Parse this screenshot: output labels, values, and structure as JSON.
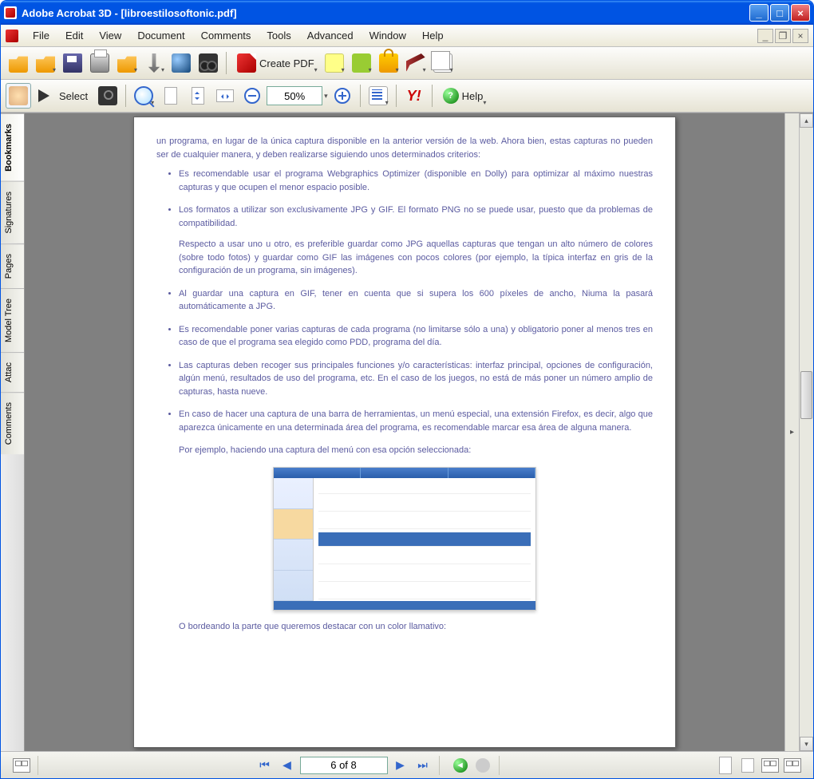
{
  "titlebar": {
    "text": "Adobe Acrobat 3D - [libroestilosoftonic.pdf]"
  },
  "menu": {
    "file": "File",
    "edit": "Edit",
    "view": "View",
    "document": "Document",
    "comments": "Comments",
    "tools": "Tools",
    "advanced": "Advanced",
    "window": "Window",
    "help": "Help"
  },
  "toolbar": {
    "create_pdf": "Create PDF",
    "select": "Select",
    "zoom": "50%",
    "help": "Help",
    "yahoo": "Y!"
  },
  "sidebar": {
    "bookmarks": "Bookmarks",
    "signatures": "Signatures",
    "pages": "Pages",
    "modeltree": "Model Tree",
    "attachments": "Attac",
    "comments": "Comments"
  },
  "status": {
    "page": "6 of 8"
  },
  "doc": {
    "intro": "un programa, en lugar de la única captura disponible en la anterior versión de la web. Ahora bien, estas capturas no pueden ser de cualquier manera, y deben realizarse siguiendo unos determinados criterios:",
    "b1": "Es recomendable usar el programa Webgraphics Optimizer (disponible en Dolly) para optimizar al máximo nuestras capturas y que ocupen el menor espacio posible.",
    "b2": "Los formatos a utilizar son exclusivamente JPG y GIF. El formato PNG no se puede usar, puesto que da problemas de compatibilidad.",
    "b2b": "Respecto a usar uno u otro, es preferible guardar como JPG aquellas capturas que tengan un alto número de colores (sobre todo fotos) y guardar como GIF las imágenes con pocos colores (por ejemplo, la típica interfaz en gris de la configuración de un programa, sin imágenes).",
    "b3": "Al guardar una captura en GIF, tener en cuenta que si supera los 600 píxeles de ancho, Niuma la pasará automáticamente a JPG.",
    "b4": "Es recomendable poner varias capturas de cada programa (no limitarse sólo a una) y obligatorio poner al menos tres en caso de que el programa sea elegido como PDD, programa del día.",
    "b5": "Las capturas deben recoger sus principales funciones y/o características: interfaz principal, opciones de configuración, algún menú, resultados de uso del programa, etc. En el caso de los juegos, no está de más poner un número amplio de capturas, hasta nueve.",
    "b6": "En caso de hacer una captura de una barra de herramientas, un menú especial, una extensión Firefox, es decir, algo que aparezca únicamente en una determinada área del programa, es recomendable marcar esa área de alguna manera.",
    "p2": "Por ejemplo, haciendo una captura del menú con esa opción seleccionada:",
    "p3": "O bordeando la parte que queremos destacar con un color llamativo:"
  }
}
